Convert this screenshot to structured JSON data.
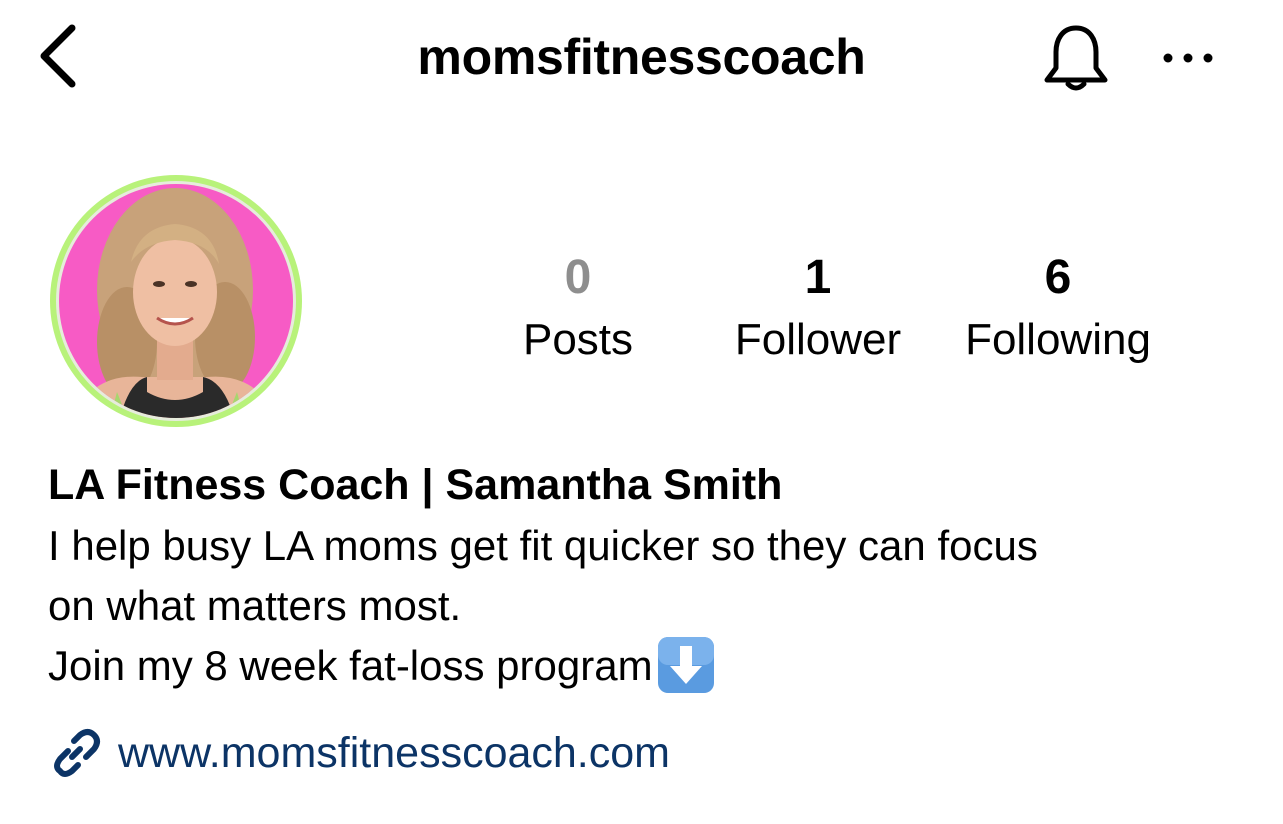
{
  "header": {
    "username": "momsfitnesscoach",
    "back_icon": "chevron-left-icon",
    "bell_icon": "bell-icon",
    "more_icon": "more-dots-icon"
  },
  "profile": {
    "avatar_ring_color": "#b8f27a",
    "avatar_bg_color": "#f75bc5"
  },
  "stats": [
    {
      "value": "0",
      "label": "Posts",
      "value_color": "#8e8e8e"
    },
    {
      "value": "1",
      "label": "Follower",
      "value_color": "#000000"
    },
    {
      "value": "6",
      "label": "Following",
      "value_color": "#000000"
    }
  ],
  "bio": {
    "name": "LA Fitness Coach | Samantha Smith",
    "line1": "I help busy LA moms get fit quicker so they can focus",
    "line2": "on what matters most.",
    "line3": "Join my 8 week fat-loss program",
    "arrow_emoji": "down-arrow-icon"
  },
  "link": {
    "icon": "link-icon",
    "text": "www.momsfitnesscoach.com",
    "color": "#0c3466"
  }
}
